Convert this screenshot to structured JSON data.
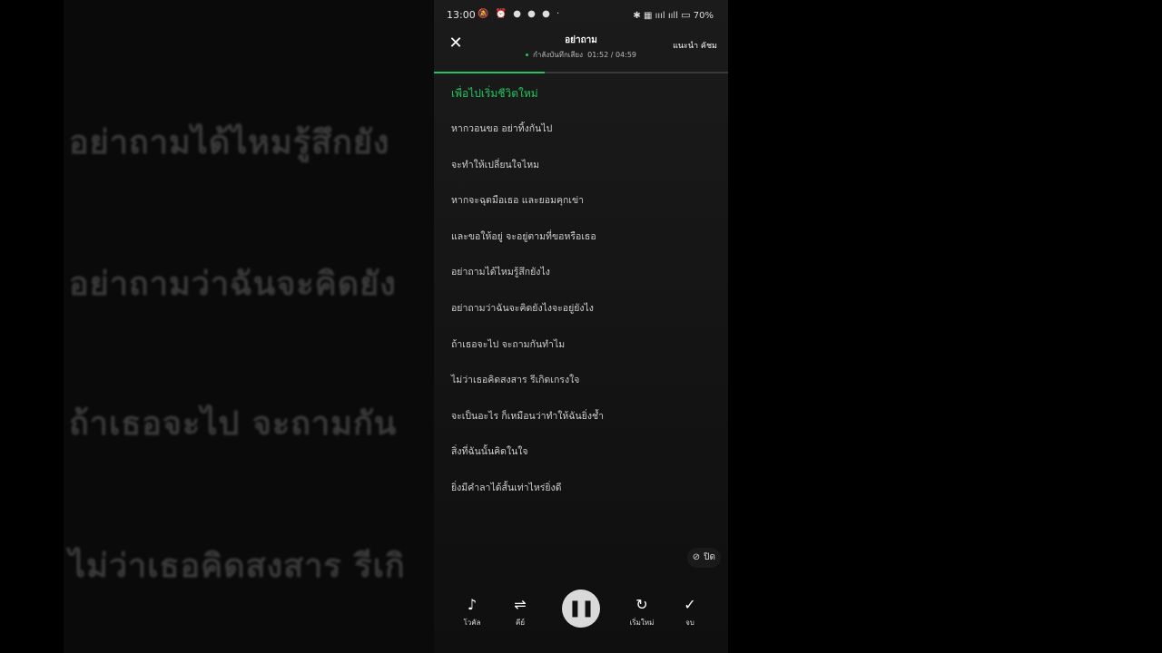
{
  "background_lyrics": [
    "อย่าถามได้ไหมรู้สึกยัง",
    "อย่าถามว่าฉันจะคิดยัง",
    "ถ้าเธอจะไป จะถามกัน",
    "ไม่ว่าเธอคิดสงสาร รีเกิ"
  ],
  "status_bar": {
    "time": "13:00",
    "left_icons": "🔕 ⏰ ● ● ● ·",
    "right_icons": "✱ ▦ ıııl ııll",
    "battery": "70"
  },
  "header": {
    "song_title": "อย่าถาม",
    "recording_status": "กำลังบันทึกเสียง",
    "time_progress": "01:52 / 04:59",
    "suggest_label": "แนะนำ คัชม",
    "progress_fraction": 0.375,
    "accent_color": "#22c55e"
  },
  "lyrics": {
    "current": "เพื่อไปเริ่มชีวิตใหม่",
    "lines": [
      "หากวอนขอ อย่าทิ้งกันไป",
      "จะทำให้เปลี่ยนใจไหม",
      "หากจะฉุดมือเธอ และยอมคุกเข่า",
      "และขอให้อยู่ จะอยู่ตามที่ขอหรือเธอ",
      "อย่าถามได้ไหมรู้สึกยังไง",
      "อย่าถามว่าฉันจะคิดยังไงจะอยู่ยังไง",
      "ถ้าเธอจะไป จะถามกันทำไม",
      "ไม่ว่าเธอคิดสงสาร รีเกิดเกรงใจ",
      "จะเป็นอะไร ก็เหมือนว่าทำให้ฉันยิ่งช้ำ",
      "สิ่งที่ฉันนั้นคิดในใจ",
      "ยิ่งมีคำลาได้สั้นเท่าไหร่ยิ่งดี"
    ]
  },
  "pin_button": {
    "label": "ปิด"
  },
  "controls": {
    "vocal_label": "โวคัล",
    "clip_label": "คีย์",
    "restart_label": "เริ่มใหม่",
    "finish_label": "จบ"
  }
}
